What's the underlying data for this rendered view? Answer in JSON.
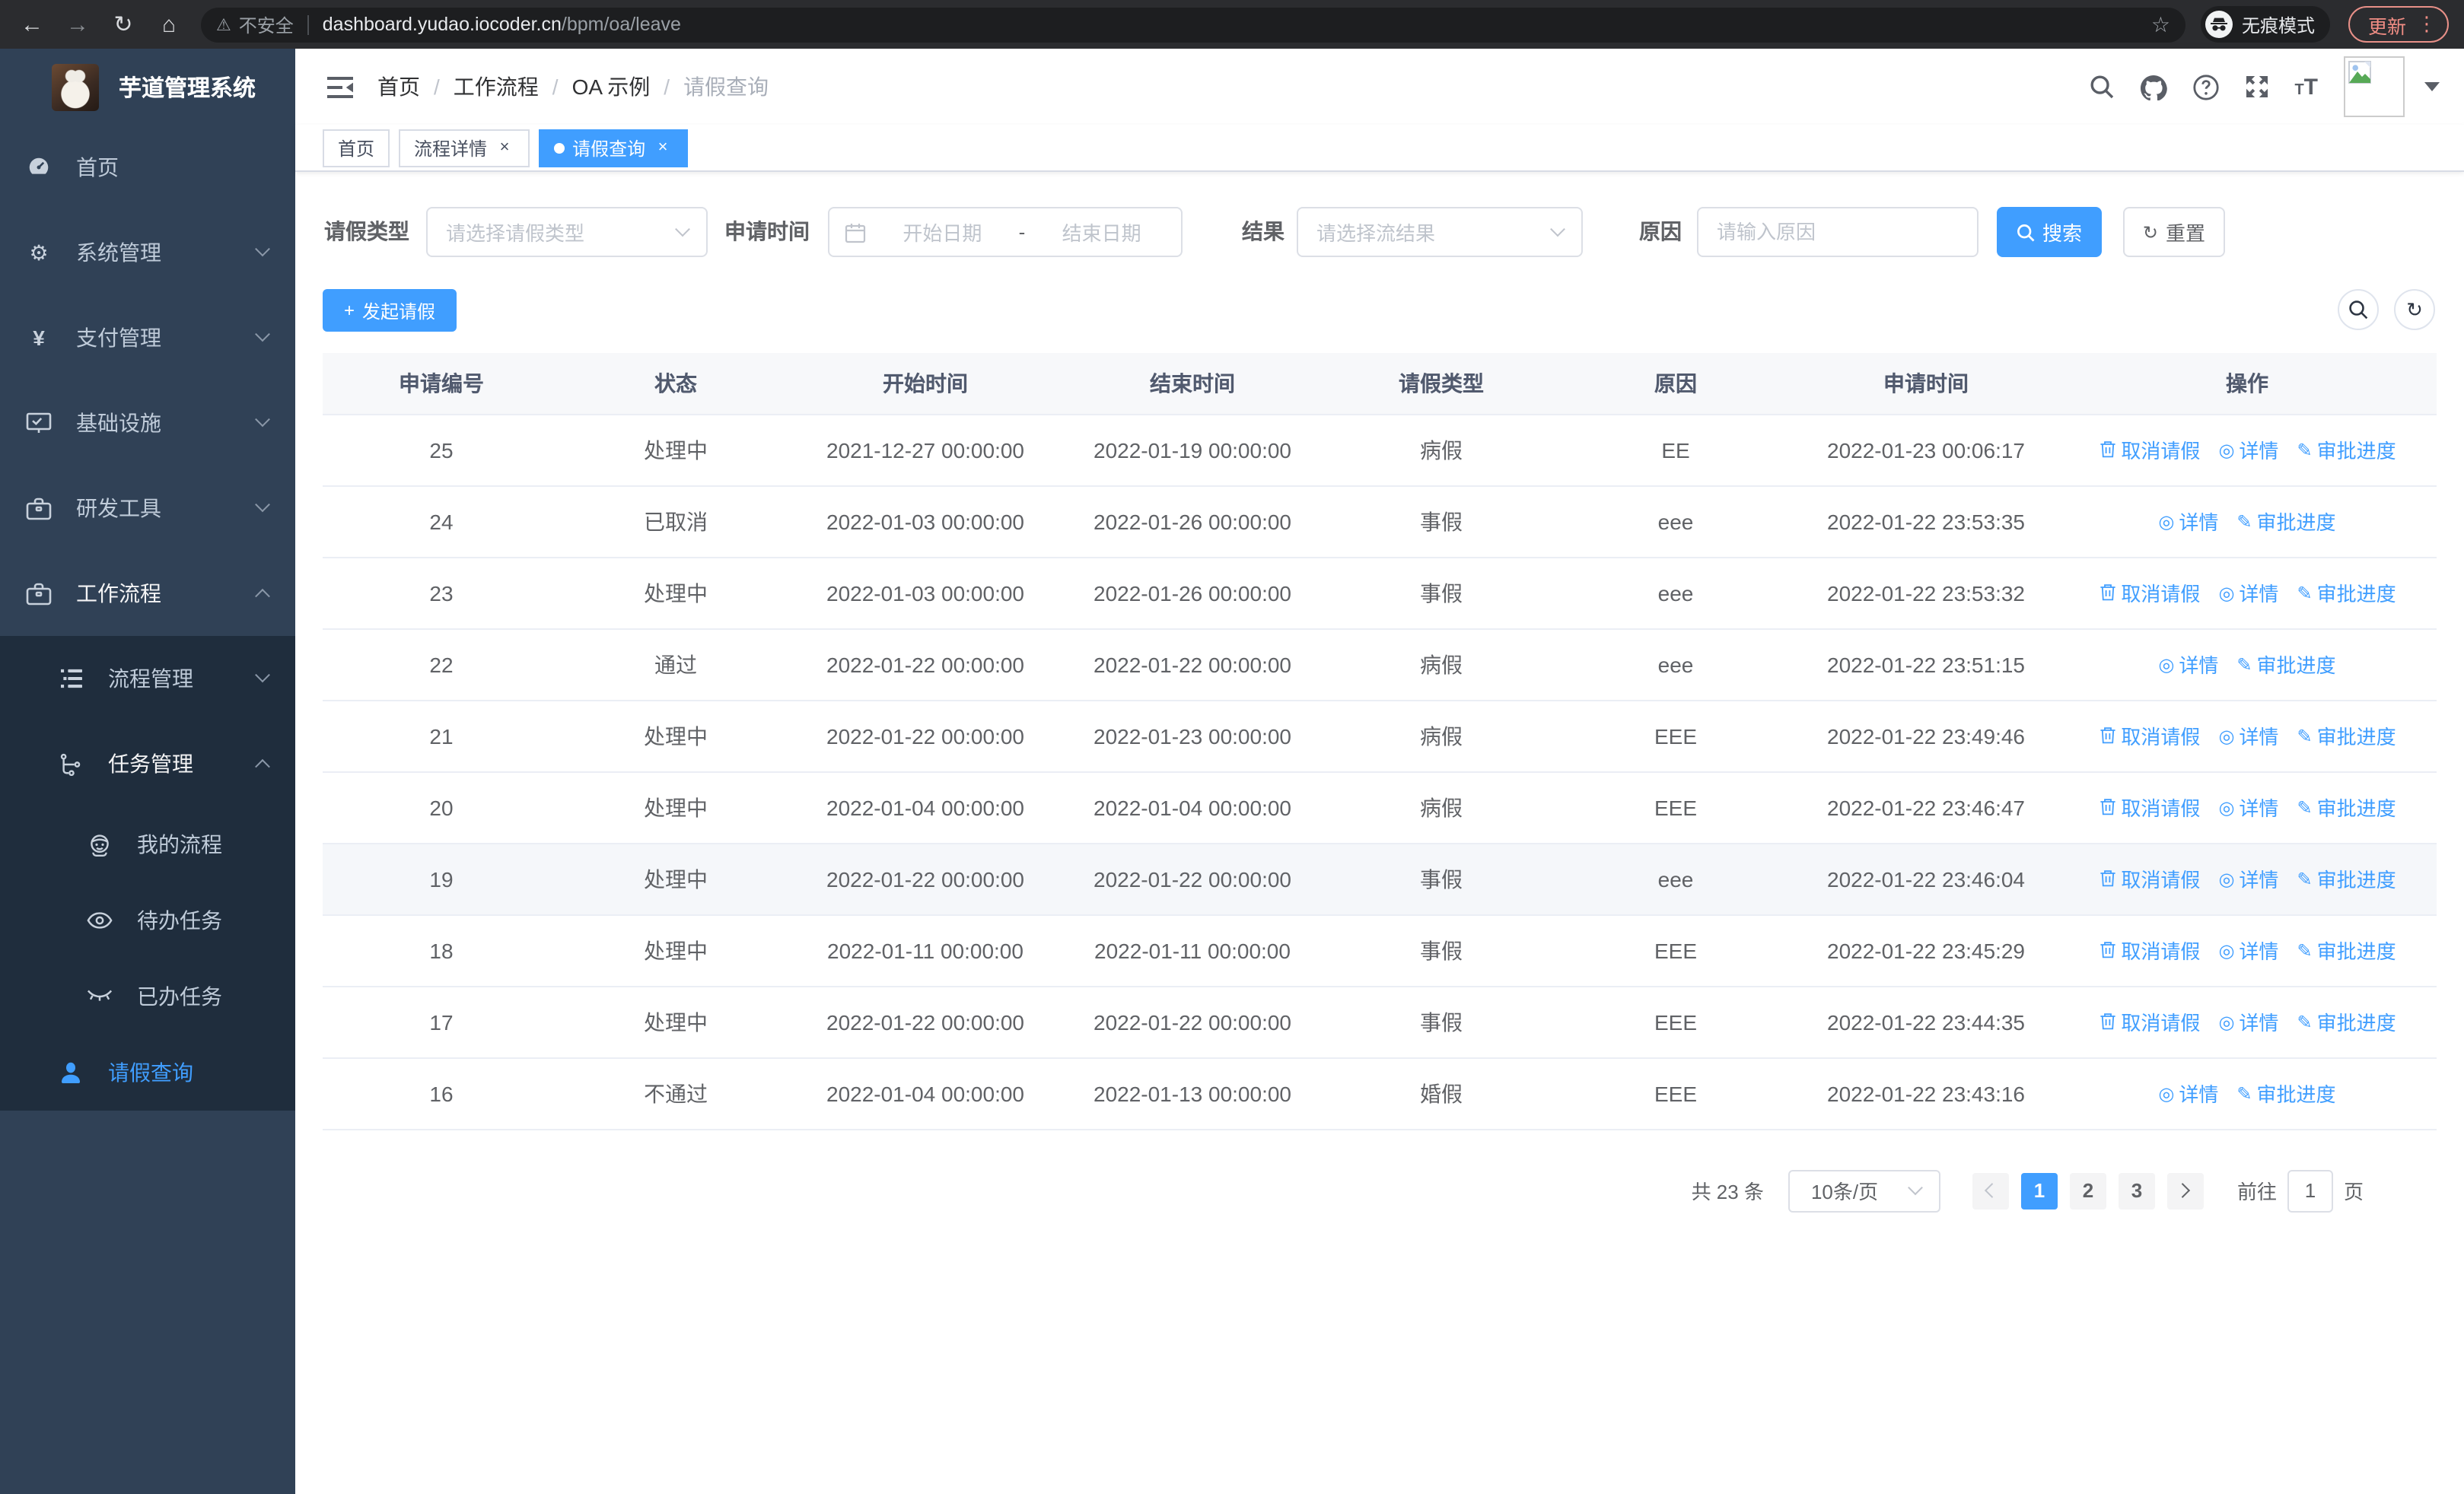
{
  "browser": {
    "security_label": "不安全",
    "url_host": "dashboard.yudao.iocoder.cn",
    "url_path": "/bpm/oa/leave",
    "incognito_label": "无痕模式",
    "update_label": "更新"
  },
  "sidebar": {
    "title": "芋道管理系统",
    "items": [
      {
        "label": "首页"
      },
      {
        "label": "系统管理"
      },
      {
        "label": "支付管理"
      },
      {
        "label": "基础设施"
      },
      {
        "label": "研发工具"
      },
      {
        "label": "工作流程"
      },
      {
        "label": "流程管理"
      },
      {
        "label": "任务管理"
      },
      {
        "label": "我的流程"
      },
      {
        "label": "待办任务"
      },
      {
        "label": "已办任务"
      },
      {
        "label": "请假查询"
      }
    ]
  },
  "header": {
    "breadcrumb": [
      "首页",
      "工作流程",
      "OA 示例",
      "请假查询"
    ],
    "separator": "/"
  },
  "tabs": [
    {
      "label": "首页"
    },
    {
      "label": "流程详情"
    },
    {
      "label": "请假查询"
    }
  ],
  "filters": {
    "leave_type_label": "请假类型",
    "leave_type_placeholder": "请选择请假类型",
    "apply_time_label": "申请时间",
    "date_start_placeholder": "开始日期",
    "date_separator": "-",
    "date_end_placeholder": "结束日期",
    "result_label": "结果",
    "result_placeholder": "请选择流结果",
    "reason_label": "原因",
    "reason_placeholder": "请输入原因",
    "search_label": "搜索",
    "reset_label": "重置"
  },
  "toolbar": {
    "create_label": "发起请假"
  },
  "table": {
    "headers": [
      "申请编号",
      "状态",
      "开始时间",
      "结束时间",
      "请假类型",
      "原因",
      "申请时间",
      "操作"
    ],
    "action_labels": {
      "cancel": "取消请假",
      "detail": "详情",
      "progress": "审批进度"
    },
    "rows": [
      {
        "id": "25",
        "status": "处理中",
        "start": "2021-12-27 00:00:00",
        "end": "2022-01-19 00:00:00",
        "type": "病假",
        "reason": "EE",
        "apply": "2022-01-23 00:06:17",
        "actions": [
          "cancel",
          "detail",
          "progress"
        ],
        "highlighted": false
      },
      {
        "id": "24",
        "status": "已取消",
        "start": "2022-01-03 00:00:00",
        "end": "2022-01-26 00:00:00",
        "type": "事假",
        "reason": "eee",
        "apply": "2022-01-22 23:53:35",
        "actions": [
          "detail",
          "progress"
        ],
        "highlighted": false
      },
      {
        "id": "23",
        "status": "处理中",
        "start": "2022-01-03 00:00:00",
        "end": "2022-01-26 00:00:00",
        "type": "事假",
        "reason": "eee",
        "apply": "2022-01-22 23:53:32",
        "actions": [
          "cancel",
          "detail",
          "progress"
        ],
        "highlighted": false
      },
      {
        "id": "22",
        "status": "通过",
        "start": "2022-01-22 00:00:00",
        "end": "2022-01-22 00:00:00",
        "type": "病假",
        "reason": "eee",
        "apply": "2022-01-22 23:51:15",
        "actions": [
          "detail",
          "progress"
        ],
        "highlighted": false
      },
      {
        "id": "21",
        "status": "处理中",
        "start": "2022-01-22 00:00:00",
        "end": "2022-01-23 00:00:00",
        "type": "病假",
        "reason": "EEE",
        "apply": "2022-01-22 23:49:46",
        "actions": [
          "cancel",
          "detail",
          "progress"
        ],
        "highlighted": false
      },
      {
        "id": "20",
        "status": "处理中",
        "start": "2022-01-04 00:00:00",
        "end": "2022-01-04 00:00:00",
        "type": "病假",
        "reason": "EEE",
        "apply": "2022-01-22 23:46:47",
        "actions": [
          "cancel",
          "detail",
          "progress"
        ],
        "highlighted": false
      },
      {
        "id": "19",
        "status": "处理中",
        "start": "2022-01-22 00:00:00",
        "end": "2022-01-22 00:00:00",
        "type": "事假",
        "reason": "eee",
        "apply": "2022-01-22 23:46:04",
        "actions": [
          "cancel",
          "detail",
          "progress"
        ],
        "highlighted": true
      },
      {
        "id": "18",
        "status": "处理中",
        "start": "2022-01-11 00:00:00",
        "end": "2022-01-11 00:00:00",
        "type": "事假",
        "reason": "EEE",
        "apply": "2022-01-22 23:45:29",
        "actions": [
          "cancel",
          "detail",
          "progress"
        ],
        "highlighted": false
      },
      {
        "id": "17",
        "status": "处理中",
        "start": "2022-01-22 00:00:00",
        "end": "2022-01-22 00:00:00",
        "type": "事假",
        "reason": "EEE",
        "apply": "2022-01-22 23:44:35",
        "actions": [
          "cancel",
          "detail",
          "progress"
        ],
        "highlighted": false
      },
      {
        "id": "16",
        "status": "不通过",
        "start": "2022-01-04 00:00:00",
        "end": "2022-01-13 00:00:00",
        "type": "婚假",
        "reason": "EEE",
        "apply": "2022-01-22 23:43:16",
        "actions": [
          "detail",
          "progress"
        ],
        "highlighted": false
      }
    ]
  },
  "pagination": {
    "total_label": "共 23 条",
    "page_size_label": "10条/页",
    "pages": [
      "1",
      "2",
      "3"
    ],
    "active_page": "1",
    "goto_label": "前往",
    "goto_value": "1",
    "page_unit": "页"
  },
  "colors": {
    "accent": "#409eff",
    "sidebar_bg": "#304156",
    "submenu_bg": "#1f2d3d"
  }
}
